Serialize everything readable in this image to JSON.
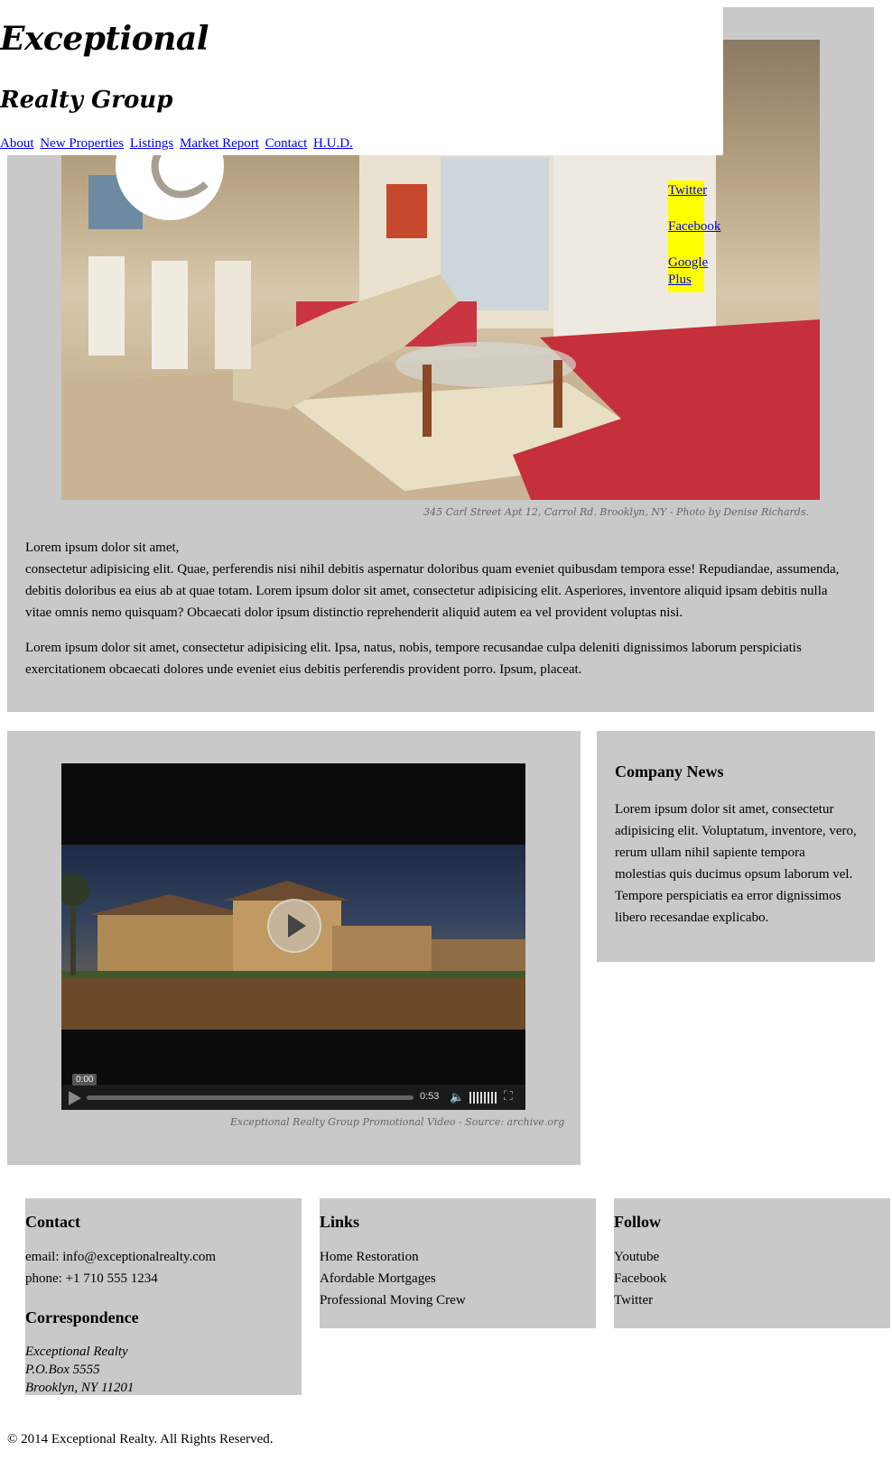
{
  "header": {
    "logo_line1": "Exceptional",
    "logo_line2": "Realty Group",
    "nav": [
      "About",
      "New Properties",
      "Listings",
      "Market Report",
      "Contact",
      "H.U.D."
    ]
  },
  "social": [
    "Twitter",
    "Facebook",
    "Google Plus"
  ],
  "hero": {
    "caption": "345 Carl Street Apt 12, Carrol Rd. Brooklyn, NY - Photo by Denise Richards.",
    "paragraph1_line1": "Lorem ipsum dolor sit amet,",
    "paragraph1_rest": "consectetur adipisicing elit. Quae, perferendis nisi nihil debitis aspernatur doloribus quam eveniet quibusdam tempora esse! Repudiandae, assumenda, debitis doloribus ea eius ab at quae totam. Lorem ipsum dolor sit amet, consectetur adipisicing elit. Asperiores, inventore aliquid ipsam debitis nulla vitae omnis nemo quisquam? Obcaecati dolor ipsum distinctio reprehenderit aliquid autem ea vel provident voluptas nisi.",
    "paragraph2": "Lorem ipsum dolor sit amet, consectetur adipisicing elit. Ipsa, natus, nobis, tempore recusandae culpa deleniti dignissimos laborum perspiciatis exercitationem obcaecati dolores unde eveniet eius debitis perferendis provident porro. Ipsum, placeat."
  },
  "video": {
    "current_time": "0:00",
    "duration": "0:53",
    "caption": "Exceptional Realty Group Promotional Video - Source: archive.org"
  },
  "news": {
    "title": "Company News",
    "text": "Lorem ipsum dolor sit amet, consectetur adipisicing elit. Voluptatum, inventore, vero, rerum ullam nihil sapiente tempora molestias quis ducimus opsum laborum vel. Tempore perspiciatis ea error dignissimos libero recesandae explicabo."
  },
  "footer": {
    "contact_title": "Contact",
    "email": "email: info@exceptionalrealty.com",
    "phone": "phone: +1 710 555 1234",
    "correspondence_title": "Correspondence",
    "address": [
      "Exceptional Realty",
      "P.O.Box 5555",
      "Brooklyn, NY 11201"
    ],
    "links_title": "Links",
    "links": [
      "Home Restoration",
      "Afordable Mortgages",
      "Professional Moving Crew"
    ],
    "follow_title": "Follow",
    "follow": [
      "Youtube",
      "Facebook",
      "Twitter"
    ],
    "copyright": "© 2014 Exceptional Realty. All Rights Reserved."
  },
  "colors": {
    "panel_bg": "#c9c9c9",
    "social_bg": "#ffff00",
    "link": "#0000ee"
  }
}
